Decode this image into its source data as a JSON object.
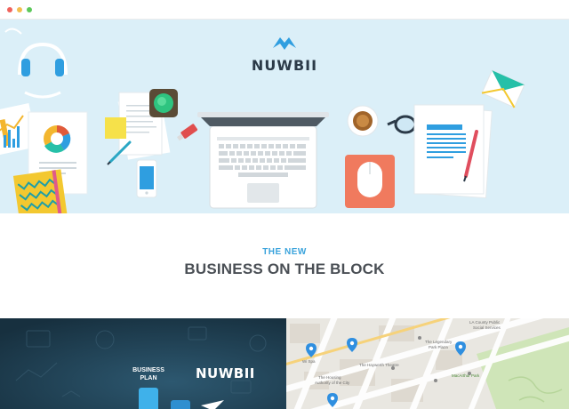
{
  "window": {
    "controls": [
      "close",
      "minimize",
      "maximize"
    ]
  },
  "hero": {
    "brand_name": "NUWBII",
    "colors": {
      "background": "#dbeff8",
      "brand_blue": "#2f9ee0",
      "text_dark": "#2b3a48"
    }
  },
  "tagline": {
    "eyebrow": "THE NEW",
    "headline": "BUSINESS ON THE BLOCK",
    "colors": {
      "eyebrow": "#3aa3dc",
      "headline": "#4a4f55"
    }
  },
  "tiles": {
    "business_plan": {
      "label_line1": "BUSINESS",
      "label_line2": "PLAN",
      "brand": "NUWBII"
    },
    "map": {
      "labels": {
        "la_county": "LA County Public",
        "social": "Social Services",
        "legendary": "The Legendary",
        "park_plaza": "Park Plaza",
        "haywerth": "The Haywerth Theatre",
        "macarthur": "MacArthur Park",
        "wi_spa": "Wi Spa",
        "housing1": "The Housing",
        "housing2": "Authority of the City"
      }
    }
  }
}
